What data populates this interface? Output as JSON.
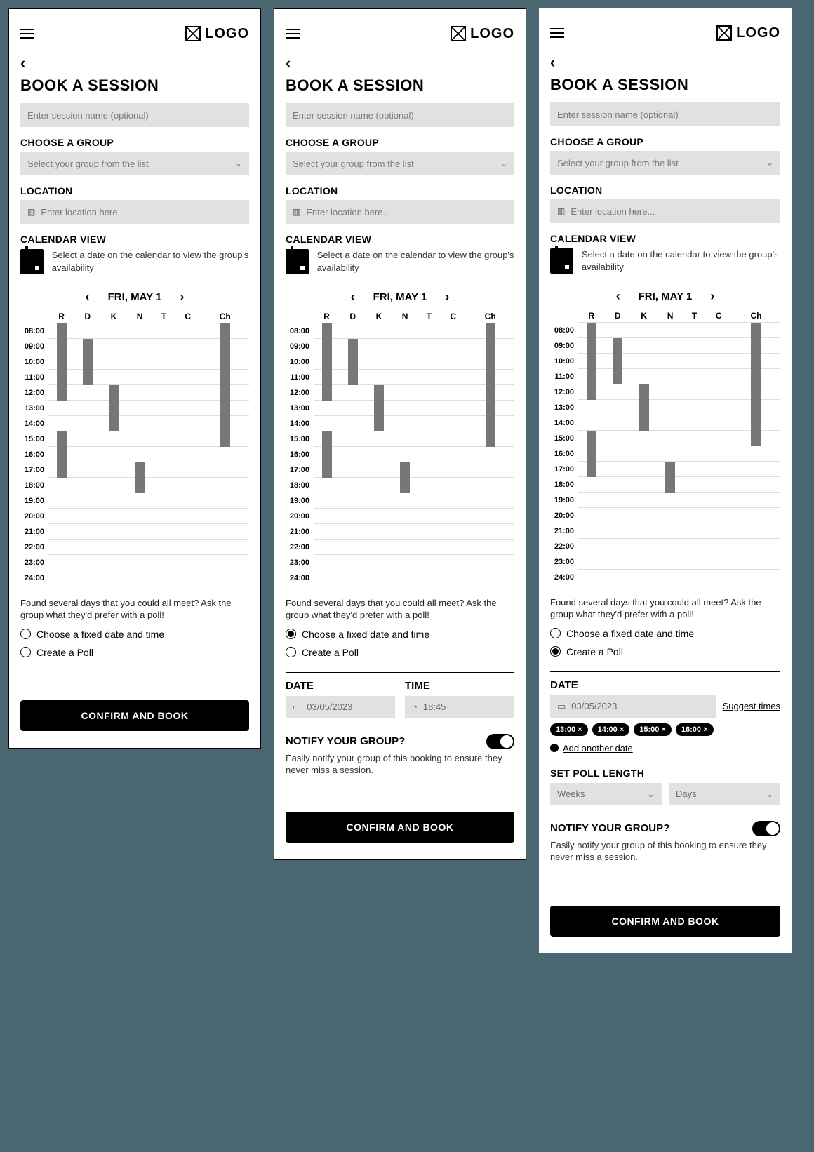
{
  "logo_text": "LOGO",
  "page_title": "BOOK A SESSION",
  "session_placeholder": "Enter session name (optional)",
  "group_label": "CHOOSE A GROUP",
  "group_placeholder": "Select your group from the list",
  "location_label": "LOCATION",
  "location_placeholder": "Enter location here...",
  "calendar_label": "CALENDAR VIEW",
  "calendar_desc": "Select a date on the calendar to view the group's availability",
  "date_display": "FRI, MAY 1",
  "people": [
    "R",
    "D",
    "K",
    "N",
    "T",
    "C",
    "Ch"
  ],
  "hours": [
    "08:00",
    "09:00",
    "10:00",
    "11:00",
    "12:00",
    "13:00",
    "14:00",
    "15:00",
    "16:00",
    "17:00",
    "18:00",
    "19:00",
    "20:00",
    "21:00",
    "22:00",
    "23:00",
    "24:00"
  ],
  "busy": [
    {
      "col": 0,
      "start": 0,
      "span": 5
    },
    {
      "col": 0,
      "start": 7,
      "span": 3
    },
    {
      "col": 1,
      "start": 1,
      "span": 3
    },
    {
      "col": 2,
      "start": 4,
      "span": 3
    },
    {
      "col": 3,
      "start": 9,
      "span": 2
    },
    {
      "col": 6,
      "start": 0,
      "span": 3
    },
    {
      "col": 6,
      "start": 3,
      "span": 5
    }
  ],
  "poll_note": "Found several days that you could all meet? Ask the group what they'd prefer with a poll!",
  "radio_fixed": "Choose a fixed date and time",
  "radio_poll": "Create a Poll",
  "confirm_label": "CONFIRM AND BOOK",
  "date_label": "DATE",
  "time_label": "TIME",
  "date_value": "03/05/2023",
  "time_value": "18:45",
  "notify_title": "NOTIFY YOUR GROUP?",
  "notify_desc": "Easily notify your group of this booking to ensure they never miss a session.",
  "suggest_link": "Suggest times",
  "time_chips": [
    "13:00 ×",
    "14:00 ×",
    "15:00 ×",
    "16:00 ×"
  ],
  "add_another": "Add another date",
  "poll_length_label": "SET POLL LENGTH",
  "weeks_placeholder": "Weeks",
  "days_placeholder": "Days"
}
